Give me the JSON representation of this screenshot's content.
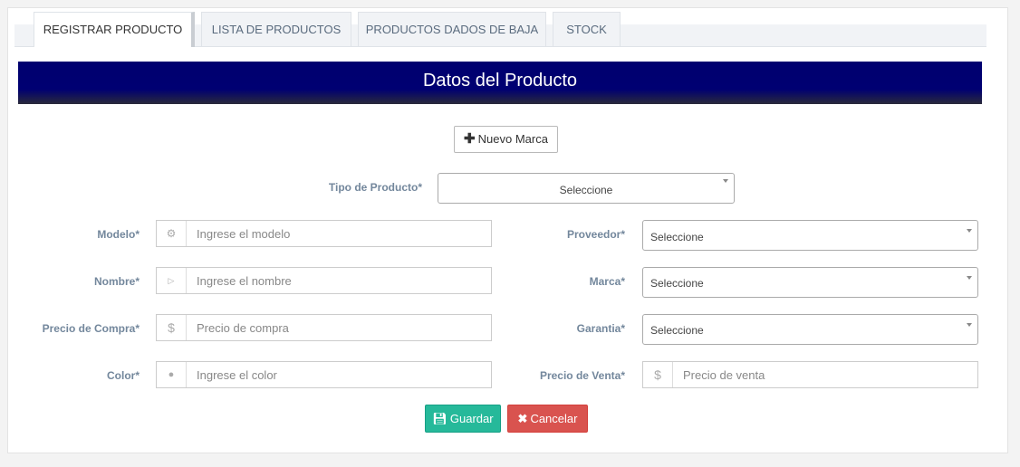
{
  "tabs": [
    {
      "label": "REGISTRAR PRODUCTO"
    },
    {
      "label": "LISTA DE PRODUCTOS"
    },
    {
      "label": "PRODUCTOS DADOS DE BAJA"
    },
    {
      "label": "STOCK"
    }
  ],
  "header": {
    "title": "Datos del Producto"
  },
  "new_brand_button": {
    "label": "Nuevo Marca",
    "icon": "plus-icon"
  },
  "product_type": {
    "label": "Tipo de Producto*",
    "value": "Seleccione"
  },
  "fields": {
    "modelo": {
      "label": "Modelo*",
      "placeholder": "Ingrese el modelo",
      "icon": "gear-icon"
    },
    "nombre": {
      "label": "Nombre*",
      "placeholder": "Ingrese el nombre",
      "icon": "play-box-icon"
    },
    "precio_compra": {
      "label": "Precio de Compra*",
      "placeholder": "Precio de compra",
      "icon": "dollar-icon"
    },
    "color": {
      "label": "Color*",
      "placeholder": "Ingrese el color",
      "icon": "tint-icon"
    },
    "proveedor": {
      "label": "Proveedor*",
      "value": "Seleccione"
    },
    "marca": {
      "label": "Marca*",
      "value": "Seleccione"
    },
    "garantia": {
      "label": "Garantia*",
      "value": "Seleccione"
    },
    "precio_venta": {
      "label": "Precio de Venta*",
      "placeholder": "Precio de venta",
      "icon": "dollar-icon"
    }
  },
  "actions": {
    "save": "Guardar",
    "cancel": "Cancelar"
  },
  "colors": {
    "header": "#00006f",
    "save": "#26b99a",
    "cancel": "#d9534f"
  }
}
